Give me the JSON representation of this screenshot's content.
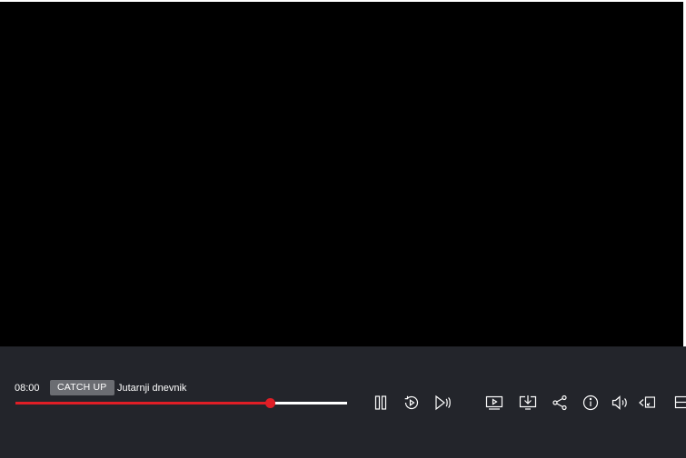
{
  "player": {
    "start_time": "08:00",
    "badge": "CATCH UP",
    "program_title": "Jutarnji dnevnik",
    "progress": 0.767,
    "accent_color": "#e01e26"
  },
  "controls": [
    "pause-icon",
    "replay-icon",
    "skip-forward-icon",
    "tv-guide-icon",
    "download-icon",
    "share-icon",
    "info-icon",
    "volume-icon",
    "cast-icon",
    "fullscreen-icon"
  ]
}
